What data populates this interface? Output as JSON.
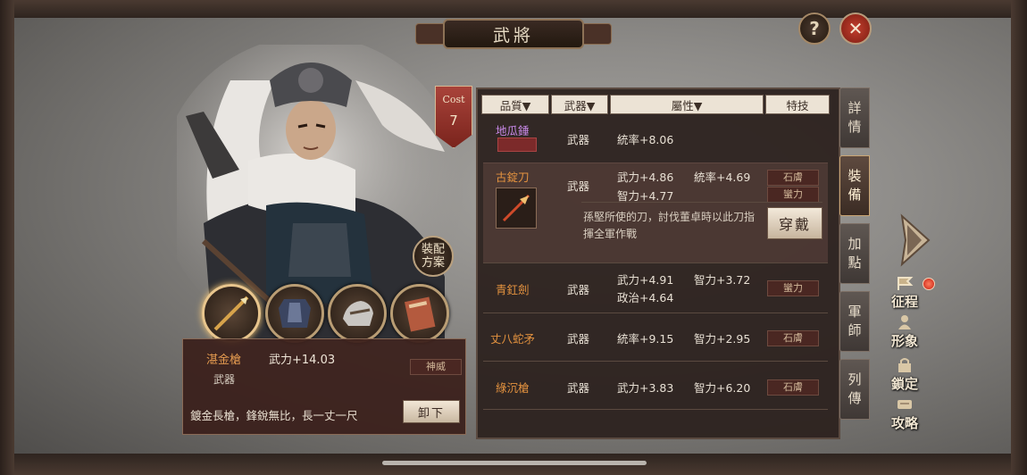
{
  "title": "武將",
  "buttons": {
    "help": "?",
    "close": "✕",
    "loadout": "裝配方案",
    "unequip": "卸下",
    "wear": "穿戴"
  },
  "cost": {
    "label": "Cost",
    "value": "7"
  },
  "equipped": {
    "name": "湛金槍",
    "type": "武器",
    "stat": "武力+14.03",
    "skill": "神威",
    "description": "鍍金長槍，鋒銳無比，長一丈一尺"
  },
  "slots": [
    "spear-icon",
    "armor-icon",
    "horse-icon",
    "book-icon"
  ],
  "headers": {
    "quality": "品質▼",
    "weapon": "武器▼",
    "attribute": "屬性▼",
    "skill": "特技"
  },
  "items": [
    {
      "name": "地瓜錘",
      "name_color": "#c889e8",
      "type": "武器",
      "stats": [
        "統率+8.06"
      ],
      "tag": ""
    },
    {
      "name": "古錠刀",
      "name_color": "#e3923f",
      "type": "武器",
      "stats": [
        "武力+4.86",
        "統率+4.69",
        "智力+4.77"
      ],
      "tags": [
        "石膚",
        "蠻力"
      ],
      "description": "孫堅所使的刀，討伐董卓時以此刀指揮全軍作戰"
    },
    {
      "name": "青釭劍",
      "name_color": "#e3923f",
      "type": "武器",
      "stats": [
        "武力+4.91",
        "智力+3.72",
        "政治+4.64"
      ],
      "tag": "蠻力"
    },
    {
      "name": "丈八蛇矛",
      "name_color": "#e3923f",
      "type": "武器",
      "stats": [
        "統率+9.15",
        "智力+2.95"
      ],
      "tag": "石膚"
    },
    {
      "name": "綠沉槍",
      "name_color": "#e3923f",
      "type": "武器",
      "stats": [
        "武力+3.83",
        "智力+6.20"
      ],
      "tag": "石膚"
    }
  ],
  "tabs": [
    "詳情",
    "裝備",
    "加點",
    "軍師",
    "列傳"
  ],
  "side_menu": [
    "征程",
    "形象",
    "鎖定",
    "攻略"
  ]
}
